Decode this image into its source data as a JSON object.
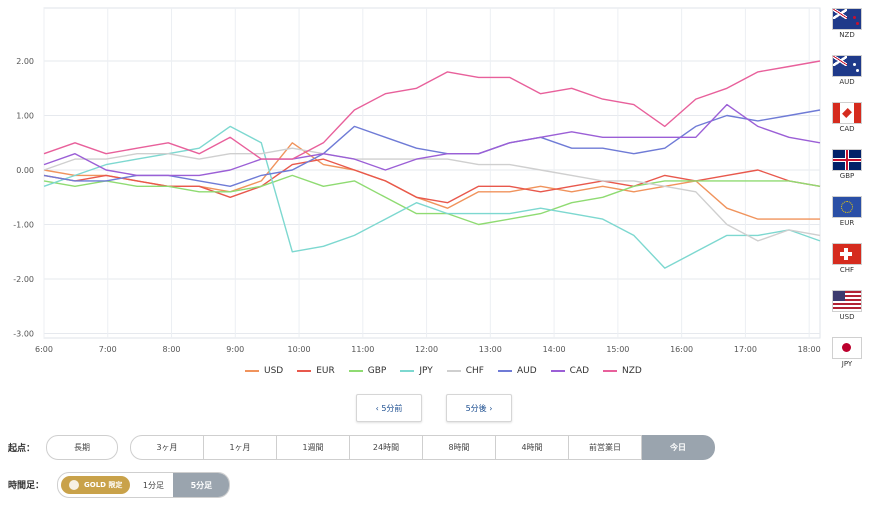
{
  "chart_data": {
    "type": "line",
    "x": [
      "6:00",
      "6:30",
      "7:00",
      "7:30",
      "8:00",
      "8:30",
      "9:00",
      "9:30",
      "10:00",
      "10:30",
      "11:00",
      "11:30",
      "12:00",
      "12:30",
      "13:00",
      "13:30",
      "14:00",
      "14:30",
      "15:00",
      "15:30",
      "16:00",
      "16:30",
      "17:00",
      "17:30",
      "18:00",
      "18:10"
    ],
    "xticks": [
      "6:00",
      "7:00",
      "8:00",
      "9:00",
      "10:00",
      "11:00",
      "12:00",
      "13:00",
      "14:00",
      "15:00",
      "16:00",
      "17:00",
      "18:00"
    ],
    "yticks": [
      "2.00",
      "1.00",
      "0.00",
      "-1.00",
      "-2.00",
      "-3.00"
    ],
    "ylim": [
      -3.0,
      2.9
    ],
    "series": [
      {
        "name": "USD",
        "color": "#f0935c",
        "values": [
          0.0,
          -0.1,
          -0.1,
          -0.2,
          -0.3,
          -0.3,
          -0.4,
          -0.2,
          0.5,
          0.1,
          0.0,
          -0.2,
          -0.5,
          -0.7,
          -0.4,
          -0.4,
          -0.3,
          -0.4,
          -0.3,
          -0.4,
          -0.3,
          -0.2,
          -0.7,
          -0.9,
          -0.9,
          -0.9
        ]
      },
      {
        "name": "EUR",
        "color": "#e8584c",
        "values": [
          -0.1,
          -0.2,
          -0.1,
          -0.2,
          -0.3,
          -0.3,
          -0.5,
          -0.3,
          0.1,
          0.2,
          0.0,
          -0.2,
          -0.5,
          -0.6,
          -0.3,
          -0.3,
          -0.4,
          -0.3,
          -0.2,
          -0.3,
          -0.1,
          -0.2,
          -0.1,
          0.0,
          -0.2,
          -0.3
        ]
      },
      {
        "name": "GBP",
        "color": "#8fdb72",
        "values": [
          -0.2,
          -0.3,
          -0.2,
          -0.3,
          -0.3,
          -0.4,
          -0.4,
          -0.3,
          -0.1,
          -0.3,
          -0.2,
          -0.5,
          -0.8,
          -0.8,
          -1.0,
          -0.9,
          -0.8,
          -0.6,
          -0.5,
          -0.3,
          -0.2,
          -0.2,
          -0.2,
          -0.2,
          -0.2,
          -0.3
        ]
      },
      {
        "name": "JPY",
        "color": "#7dd8d0",
        "values": [
          -0.3,
          -0.1,
          0.1,
          0.2,
          0.3,
          0.4,
          0.8,
          0.5,
          -1.5,
          -1.4,
          -1.2,
          -0.9,
          -0.6,
          -0.8,
          -0.8,
          -0.8,
          -0.7,
          -0.8,
          -0.9,
          -1.2,
          -1.8,
          -1.5,
          -1.2,
          -1.2,
          -1.1,
          -1.3
        ]
      },
      {
        "name": "CHF",
        "color": "#cfcfcf",
        "values": [
          0.0,
          0.2,
          0.2,
          0.3,
          0.3,
          0.2,
          0.3,
          0.3,
          0.4,
          0.3,
          0.2,
          0.2,
          0.2,
          0.2,
          0.1,
          0.1,
          0.0,
          -0.1,
          -0.2,
          -0.2,
          -0.3,
          -0.4,
          -1.0,
          -1.3,
          -1.1,
          -1.2
        ]
      },
      {
        "name": "AUD",
        "color": "#6f7bd6",
        "values": [
          -0.1,
          -0.2,
          -0.2,
          -0.1,
          -0.1,
          -0.2,
          -0.3,
          -0.1,
          0.0,
          0.3,
          0.8,
          0.6,
          0.4,
          0.3,
          0.3,
          0.5,
          0.6,
          0.4,
          0.4,
          0.3,
          0.4,
          0.8,
          1.0,
          0.9,
          1.0,
          1.1
        ]
      },
      {
        "name": "CAD",
        "color": "#9b5fd6",
        "values": [
          0.1,
          0.3,
          0.0,
          -0.1,
          -0.1,
          -0.1,
          0.0,
          0.2,
          0.2,
          0.3,
          0.2,
          0.0,
          0.2,
          0.3,
          0.3,
          0.5,
          0.6,
          0.7,
          0.6,
          0.6,
          0.6,
          0.6,
          1.2,
          0.8,
          0.6,
          0.5
        ]
      },
      {
        "name": "NZD",
        "color": "#e8609b",
        "values": [
          0.3,
          0.5,
          0.3,
          0.4,
          0.5,
          0.3,
          0.6,
          0.2,
          0.2,
          0.5,
          1.1,
          1.4,
          1.5,
          1.8,
          1.7,
          1.7,
          1.4,
          1.5,
          1.3,
          1.2,
          0.8,
          1.3,
          1.5,
          1.8,
          1.9,
          2.0
        ]
      }
    ]
  },
  "flags": [
    {
      "code": "NZD",
      "icon": "nz-flag-icon"
    },
    {
      "code": "AUD",
      "icon": "au-flag-icon"
    },
    {
      "code": "CAD",
      "icon": "ca-flag-icon"
    },
    {
      "code": "GBP",
      "icon": "gb-flag-icon"
    },
    {
      "code": "EUR",
      "icon": "eu-flag-icon"
    },
    {
      "code": "CHF",
      "icon": "ch-flag-icon"
    },
    {
      "code": "USD",
      "icon": "us-flag-icon"
    },
    {
      "code": "JPY",
      "icon": "jp-flag-icon"
    }
  ],
  "nav": {
    "prev": "‹ 5分前",
    "next": "5分後 ›"
  },
  "range": {
    "label": "起点：",
    "buttons": [
      "長期",
      "3ヶ月",
      "1ヶ月",
      "1週間",
      "24時間",
      "8時間",
      "4時間",
      "前営業日",
      "今日"
    ]
  },
  "interval": {
    "label": "時間足：",
    "gold": "GOLD 限定",
    "one": "1分足",
    "five": "5分足"
  }
}
